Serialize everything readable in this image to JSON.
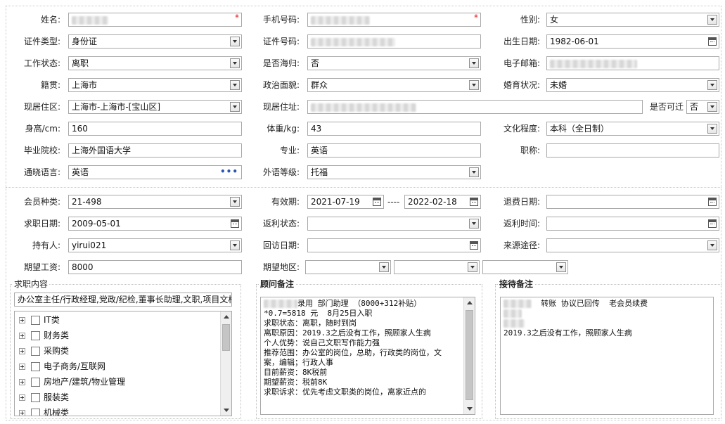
{
  "personal": {
    "name_label": "姓名:",
    "phone_label": "手机号码:",
    "gender_label": "性别:",
    "gender_value": "女",
    "id_type_label": "证件类型:",
    "id_type_value": "身份证",
    "id_number_label": "证件号码:",
    "birth_label": "出生日期:",
    "birth_value": "1982-06-01",
    "work_status_label": "工作状态:",
    "work_status_value": "离职",
    "returnee_label": "是否海归:",
    "returnee_value": "否",
    "email_label": "电子邮箱:",
    "origin_label": "籍贯:",
    "origin_value": "上海市",
    "political_label": "政治面貌:",
    "political_value": "群众",
    "marital_label": "婚育状况:",
    "marital_value": "未婚",
    "residence_area_label": "现居住区:",
    "residence_area_value": "上海市-上海市-[宝山区]",
    "residence_addr_label": "现居住址:",
    "relocate_label": "是否可迁",
    "relocate_value": "否",
    "height_label": "身高/cm:",
    "height_value": "160",
    "weight_label": "体重/kg:",
    "weight_value": "43",
    "education_label": "文化程度:",
    "education_value": "本科（全日制）",
    "school_label": "毕业院校:",
    "school_value": "上海外国语大学",
    "major_label": "专业:",
    "major_value": "英语",
    "title_label": "职称:",
    "language_label": "通晓语言:",
    "language_value": "英语",
    "language_more": "•••",
    "lang_level_label": "外语等级:",
    "lang_level_value": "托福",
    "required_mark": "*"
  },
  "membership": {
    "member_type_label": "会员种类:",
    "member_type_value": "21-498",
    "validity_label": "有效期:",
    "validity_start": "2021-07-19",
    "validity_sep": "----",
    "validity_end": "2022-02-18",
    "refund_date_label": "退费日期:",
    "job_date_label": "求职日期:",
    "job_date_value": "2009-05-01",
    "rebate_status_label": "返利状态:",
    "rebate_time_label": "返利时间:",
    "holder_label": "持有人:",
    "holder_value": "yirui021",
    "visit_date_label": "回访日期:",
    "source_label": "来源途径:",
    "salary_label": "期望工资:",
    "salary_value": "8000",
    "region_label": "期望地区:"
  },
  "job_panel": {
    "title": "求职内容",
    "summary": "办公室主任/行政经理,党政/纪检,董事长助理,文职,项目文档",
    "categories": [
      "IT类",
      "财务类",
      "采购类",
      "电子商务/互联网",
      "房地产/建筑/物业管理",
      "服装类",
      "机械类"
    ]
  },
  "advisor_panel": {
    "title": "顾问备注",
    "lines": [
      "录用 部门助理 （8000+312补贴）",
      "*0.7=5818 元  8月25日入职",
      "",
      "求职状态：离职，随时到岗",
      "离职原因：2019.3之后没有工作，照顾家人生病",
      "个人优势：说自己文职写作能力强",
      "推荐范围：办公室的岗位，总助，行政类的岗位，文",
      "案，编辑；行政人事",
      "目前薪资：8K税前",
      "期望薪资：税前8K",
      "求职诉求：优先考虑文职类的岗位，离家近点的"
    ]
  },
  "receipt_panel": {
    "title": "接待备注",
    "line1": "转账 协议已回传  老会员续费",
    "line2": "2019.3之后没有工作，照顾家人生病"
  }
}
